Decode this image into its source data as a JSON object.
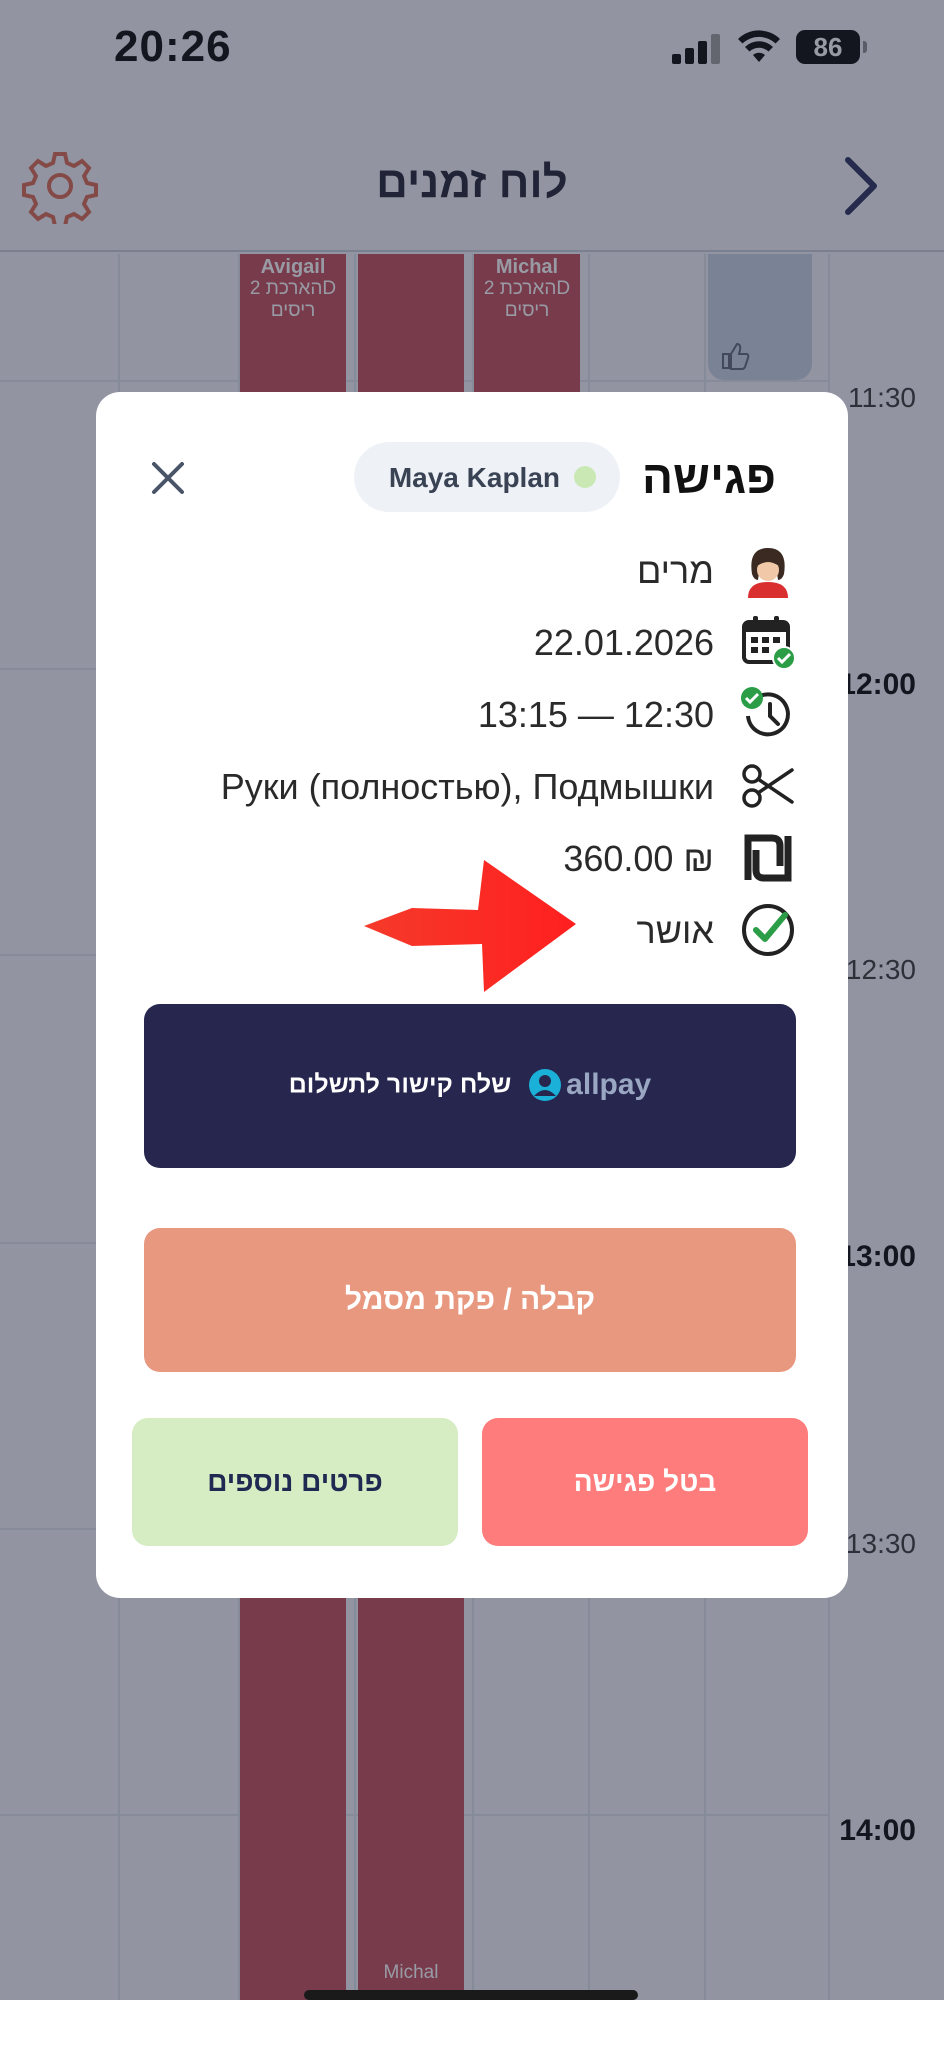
{
  "status_bar": {
    "time": "20:26",
    "battery": "86"
  },
  "header": {
    "title": "לוח זמנים"
  },
  "calendar": {
    "time_labels": [
      {
        "label": "11:30",
        "bold": false
      },
      {
        "label": "12:00",
        "bold": true
      },
      {
        "label": "12:30",
        "bold": false
      },
      {
        "label": "13:00",
        "bold": true
      },
      {
        "label": "13:30",
        "bold": false
      },
      {
        "label": "14:00",
        "bold": true
      }
    ],
    "appointments": [
      {
        "name": "Avigail",
        "line1": "הארכת 2D",
        "line2": "ריסים"
      },
      {
        "name": "Michal",
        "line1": "הארכת 2D",
        "line2": "ריסים"
      },
      {
        "name": "Michal"
      }
    ]
  },
  "modal": {
    "title": "פגישה",
    "staff_name": "Maya Kaplan",
    "client": "מרים",
    "date": "22.01.2026",
    "time": "13:15 — 12:30",
    "services": "Руки (полностью), Подмышки",
    "price": "360.00 ₪",
    "status": "אושר",
    "allpay_label": "שלח קישור לתשלום",
    "allpay_brand": "allpay",
    "receipt_label": "קבלה / פקת מסמל",
    "more_details_label": "פרטים נוספים",
    "cancel_label": "בטל פגישה"
  },
  "colors": {
    "appointment": "#c24a55",
    "allpay_bg": "#26264e",
    "receipt_bg": "#e99880",
    "more_bg": "#d6edc3",
    "cancel_bg": "#fe7c7c"
  }
}
